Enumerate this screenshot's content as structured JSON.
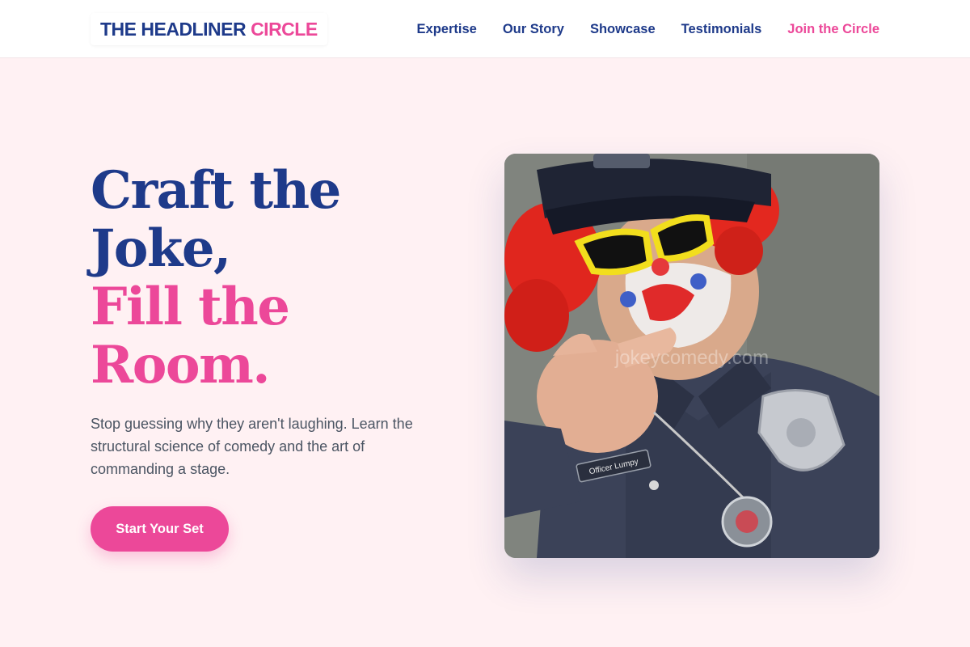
{
  "brand": {
    "name_part1": "THE HEADLINER",
    "name_part2": "CIRCLE"
  },
  "nav": {
    "items": [
      {
        "label": "Expertise"
      },
      {
        "label": "Our Story"
      },
      {
        "label": "Showcase"
      },
      {
        "label": "Testimonials"
      },
      {
        "label": "Join the Circle"
      }
    ]
  },
  "hero": {
    "headline_lines": [
      "Craft the",
      "Joke,",
      "Fill the",
      "Room."
    ],
    "subtext": "Stop guessing why they aren't laughing. Learn the structural science of comedy and the art of commanding a stage.",
    "cta_label": "Start Your Set",
    "image": {
      "subject": "clown police officer pointing at viewer",
      "watermark": "jokeycomedy.com",
      "name_tag": "Officer Lumpy"
    }
  },
  "colors": {
    "navy": "#1e3a8a",
    "pink": "#ec4899",
    "background": "#fff1f3",
    "body_text": "#4b5563"
  }
}
